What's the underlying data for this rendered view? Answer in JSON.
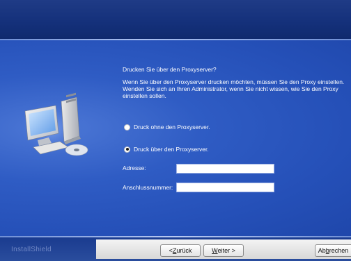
{
  "content": {
    "title": "Drucken Sie über den Proxyserver?",
    "description": "Wenn Sie über den Proxyserver drucken möchten, müssen Sie den Proxy einstellen. Wenden Sie sich an Ihren Administrator, wenn Sie nicht wissen, wie Sie den Proxy einstellen sollen.",
    "options": [
      {
        "label": "Druck ohne den Proxyserver.",
        "selected": false
      },
      {
        "label": "Druck über den Proxyserver.",
        "selected": true
      }
    ],
    "fields": {
      "address_label": "Adresse:",
      "address_value": "",
      "port_label": "Anschlussnummer:",
      "port_value": ""
    }
  },
  "footer": {
    "brand": "InstallShield",
    "back_prefix": "< ",
    "back_key": "Z",
    "back_rest": "urück",
    "next_key": "W",
    "next_rest": "eiter >",
    "cancel_pre": "Ab",
    "cancel_key": "b",
    "cancel_rest": "rechen"
  },
  "colors": {
    "header": "#1f3b86",
    "main": "#2f5cc4",
    "text": "#ffffff"
  },
  "icons": [
    "computer-icon",
    "cd-disc-icon"
  ]
}
